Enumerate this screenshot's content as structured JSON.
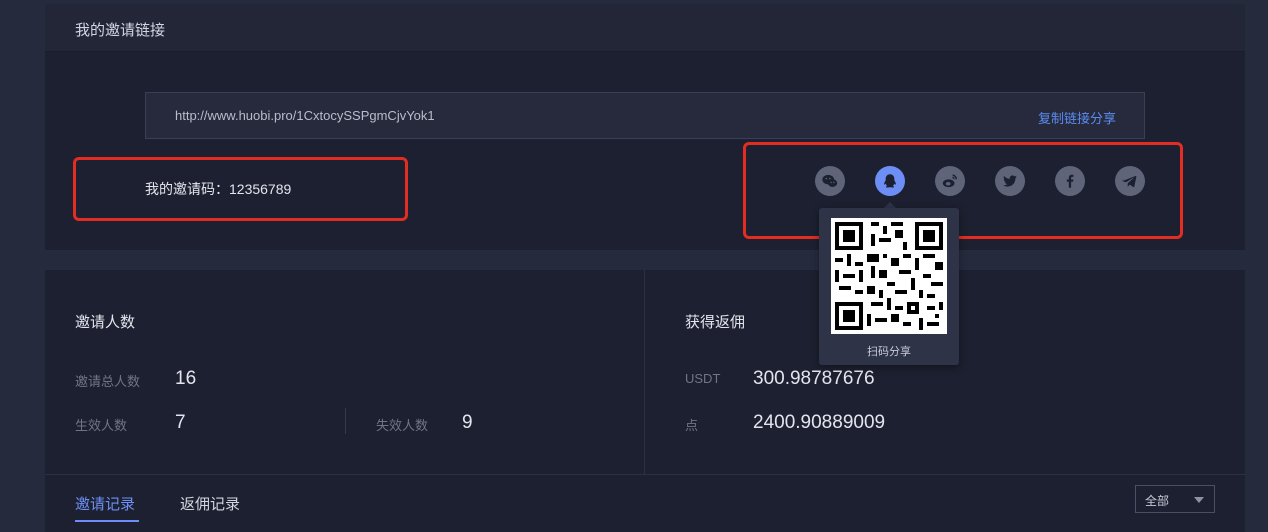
{
  "invite": {
    "title": "我的邀请链接",
    "link_url": "http://www.huobi.pro/1CxtocySSPgmCjvYok1",
    "copy_label": "复制链接分享",
    "invite_code_label": "我的邀请码：12356789"
  },
  "share_icons": [
    {
      "name": "wechat-icon",
      "active": false
    },
    {
      "name": "qq-icon",
      "active": true
    },
    {
      "name": "weibo-icon",
      "active": false
    },
    {
      "name": "twitter-icon",
      "active": false
    },
    {
      "name": "facebook-icon",
      "active": false
    },
    {
      "name": "telegram-icon",
      "active": false
    }
  ],
  "qr_popup": {
    "caption": "扫码分享"
  },
  "stats": {
    "invites": {
      "title": "邀请人数",
      "total_label": "邀请总人数",
      "total_value": "16",
      "valid_label": "生效人数",
      "valid_value": "7",
      "invalid_label": "失效人数",
      "invalid_value": "9"
    },
    "rebate": {
      "title": "获得返佣",
      "usdt_label": "USDT",
      "usdt_value": "300.98787676",
      "points_label": "点",
      "points_value": "2400.90889009"
    }
  },
  "tabs": {
    "invite_records": "邀请记录",
    "rebate_records": "返佣记录"
  },
  "filter": {
    "selected": "全部"
  },
  "colors": {
    "accent": "#6d8ff5",
    "highlight_red": "#e32d22",
    "panel_bg": "#1d2030",
    "page_bg": "#262a3d"
  }
}
